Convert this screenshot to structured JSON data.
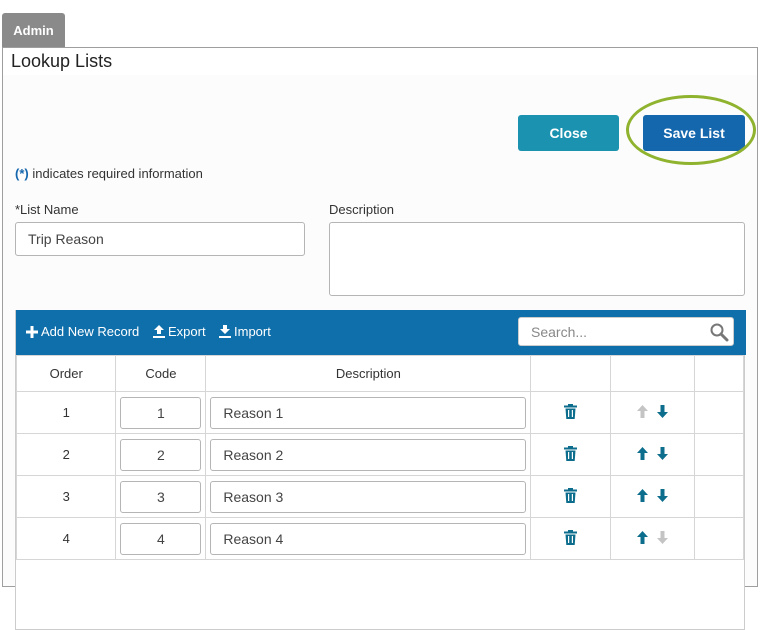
{
  "header": {
    "admin_tab": "Admin",
    "title": "Lookup Lists"
  },
  "actions": {
    "close_label": "Close",
    "save_label": "Save List"
  },
  "form": {
    "required_marker": "(*)",
    "required_note": " indicates required information",
    "list_name_label": "*List Name",
    "list_name_value": "Trip Reason",
    "description_label": "Description",
    "description_value": ""
  },
  "toolbar": {
    "add_label": "Add New Record",
    "export_label": "Export",
    "import_label": "Import",
    "search_placeholder": "Search..."
  },
  "grid": {
    "columns": {
      "order": "Order",
      "code": "Code",
      "description": "Description"
    },
    "rows": [
      {
        "order": "1",
        "code": "1",
        "description": "Reason 1",
        "up_enabled": false,
        "down_enabled": true
      },
      {
        "order": "2",
        "code": "2",
        "description": "Reason 2",
        "up_enabled": true,
        "down_enabled": true
      },
      {
        "order": "3",
        "code": "3",
        "description": "Reason 3",
        "up_enabled": true,
        "down_enabled": true
      },
      {
        "order": "4",
        "code": "4",
        "description": "Reason 4",
        "up_enabled": true,
        "down_enabled": false
      }
    ]
  },
  "colors": {
    "toolbar": "#0f6fab",
    "close_button": "#1b93b0",
    "save_button": "#1466ad",
    "highlight_ring": "#8fb32e",
    "icon_active": "#0c6d8c",
    "icon_disabled": "#c4c4c4"
  }
}
